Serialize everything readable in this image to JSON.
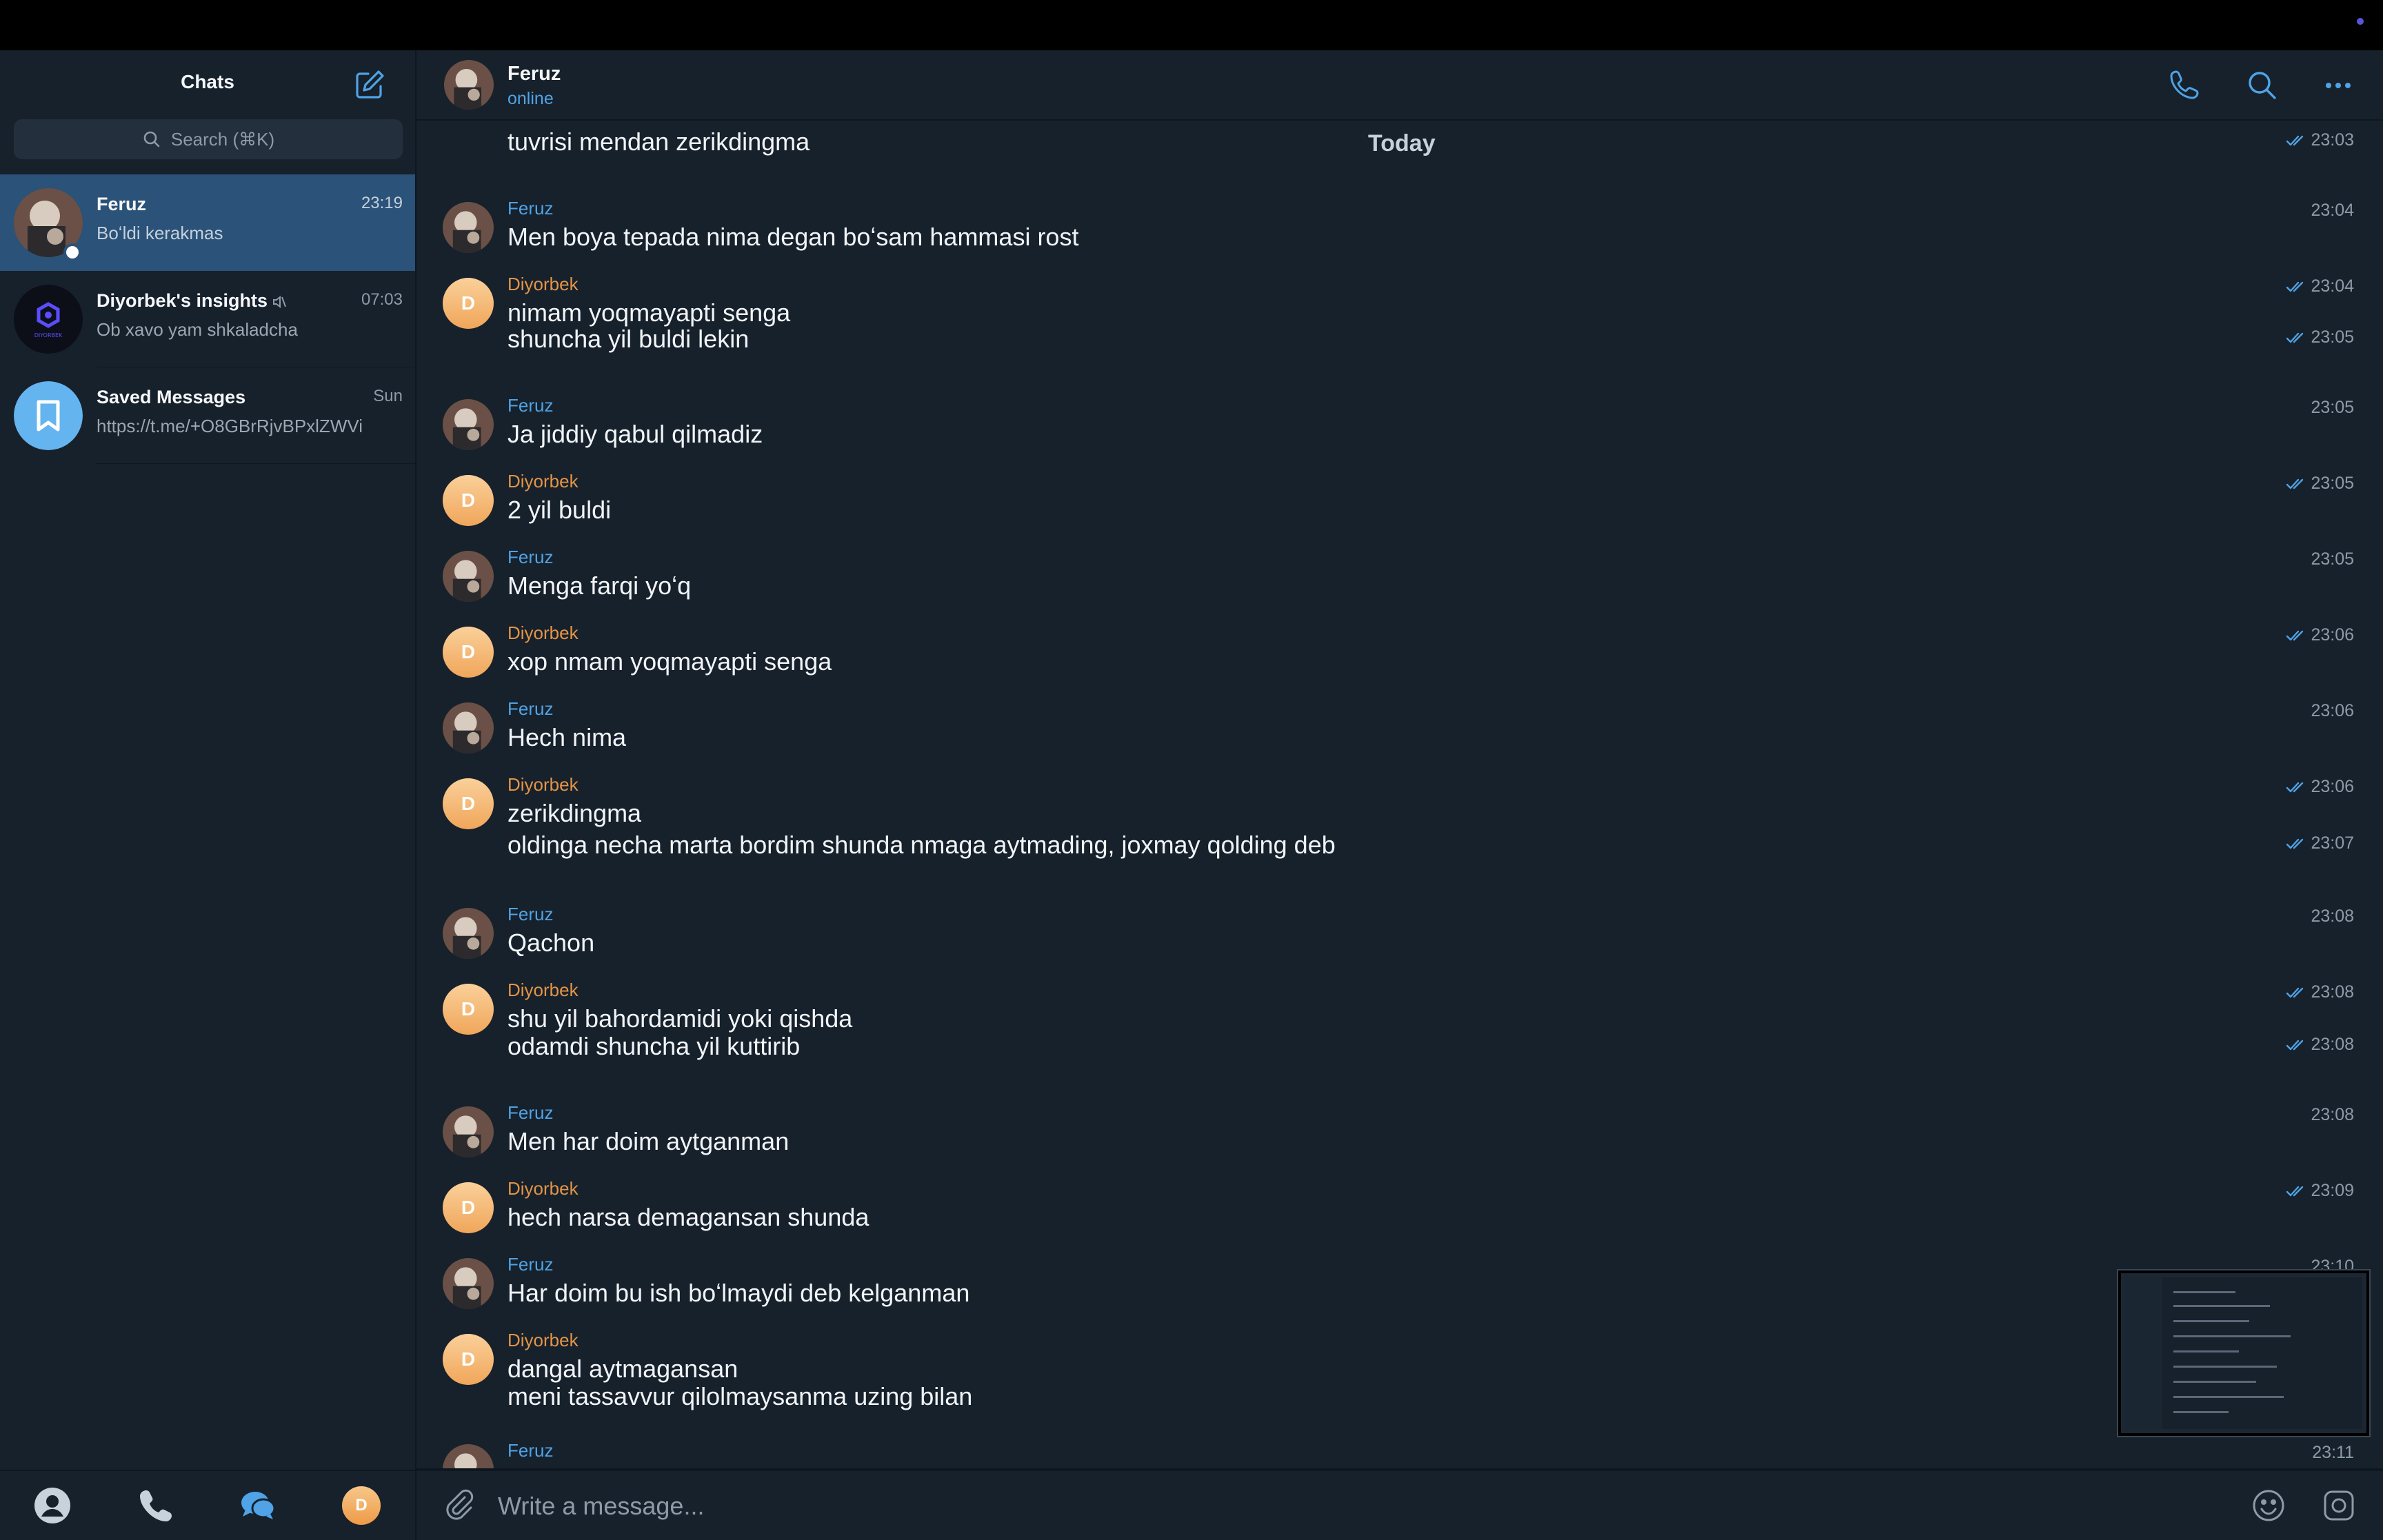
{
  "colors": {
    "accent": "#4fa3e6",
    "sidebar_bg": "#17212b",
    "active_chat_bg": "#2b5278",
    "sender_feruz": "#4fa3e6",
    "sender_diyorbek": "#e39447"
  },
  "sidebar": {
    "title": "Chats",
    "search_placeholder": "Search (⌘K)",
    "chats": [
      {
        "name": "Feruz",
        "preview": "Boʻldi kerakmas",
        "time": "23:19",
        "active": true,
        "online": true
      },
      {
        "name": "Diyorbek's insights",
        "preview": "Ob xavo yam shkaladcha",
        "time": "07:03",
        "muted": true,
        "logo_text": "DIYORBEK"
      },
      {
        "name": "Saved Messages",
        "preview": "https://t.me/+O8GBrRjvBPxlZWVi",
        "time": "Sun"
      }
    ],
    "bottom_nav": {
      "avatar_letter": "D",
      "items": [
        "contacts-icon",
        "calls-icon",
        "chats-icon",
        "profile-avatar"
      ]
    }
  },
  "chat": {
    "name": "Feruz",
    "status": "online",
    "date_label": "Today",
    "messages": [
      {
        "sender": "",
        "text": "tuvrisi mendan zerikdingma",
        "time": "23:03",
        "read": true
      },
      {
        "sender": "Feruz",
        "text": "Men boya tepada nima degan boʻsam hammasi rost",
        "time": "23:04",
        "read": false
      },
      {
        "sender": "Diyorbek",
        "text": "nimam yoqmayapti senga",
        "time": "23:04",
        "read": true
      },
      {
        "sender": "",
        "text": "shuncha yil buldi lekin",
        "time": "23:05",
        "read": true
      },
      {
        "sender": "Feruz",
        "text": "Ja jiddiy qabul qilmadiz",
        "time": "23:05",
        "read": false
      },
      {
        "sender": "Diyorbek",
        "text": "2 yil buldi",
        "time": "23:05",
        "read": true
      },
      {
        "sender": "Feruz",
        "text": "Menga farqi yoʻq",
        "time": "23:05",
        "read": false
      },
      {
        "sender": "Diyorbek",
        "text": "xop nmam yoqmayapti senga",
        "time": "23:06",
        "read": true
      },
      {
        "sender": "Feruz",
        "text": "Hech nima",
        "time": "23:06",
        "read": false
      },
      {
        "sender": "Diyorbek",
        "text": "zerikdingma",
        "time": "23:06",
        "read": true
      },
      {
        "sender": "",
        "text": "oldinga necha marta bordim shunda nmaga aytmading, joxmay qolding deb",
        "time": "23:07",
        "read": true
      },
      {
        "sender": "Feruz",
        "text": "Qachon",
        "time": "23:08",
        "read": false
      },
      {
        "sender": "Diyorbek",
        "text": "shu yil bahordamidi yoki qishda",
        "time": "23:08",
        "read": true
      },
      {
        "sender": "",
        "text": "odamdi shuncha yil kuttirib",
        "time": "23:08",
        "read": true
      },
      {
        "sender": "Feruz",
        "text": "Men har doim aytganman",
        "time": "23:08",
        "read": false
      },
      {
        "sender": "Diyorbek",
        "text": "hech narsa demagansan shunda",
        "time": "23:09",
        "read": true
      },
      {
        "sender": "Feruz",
        "text": "Har doim bu ish boʻlmaydi deb kelganman",
        "time": "23:10",
        "read": false
      },
      {
        "sender": "Diyorbek",
        "text": "dangal aytmagansan",
        "time": "",
        "read": false
      },
      {
        "sender": "",
        "text": "meni tassavvur qilolmaysanma uzing bilan",
        "time": "",
        "read": false
      },
      {
        "sender": "Feruz",
        "text": "",
        "time": "23:11",
        "read": false
      }
    ]
  },
  "composer": {
    "placeholder": "Write a message..."
  }
}
